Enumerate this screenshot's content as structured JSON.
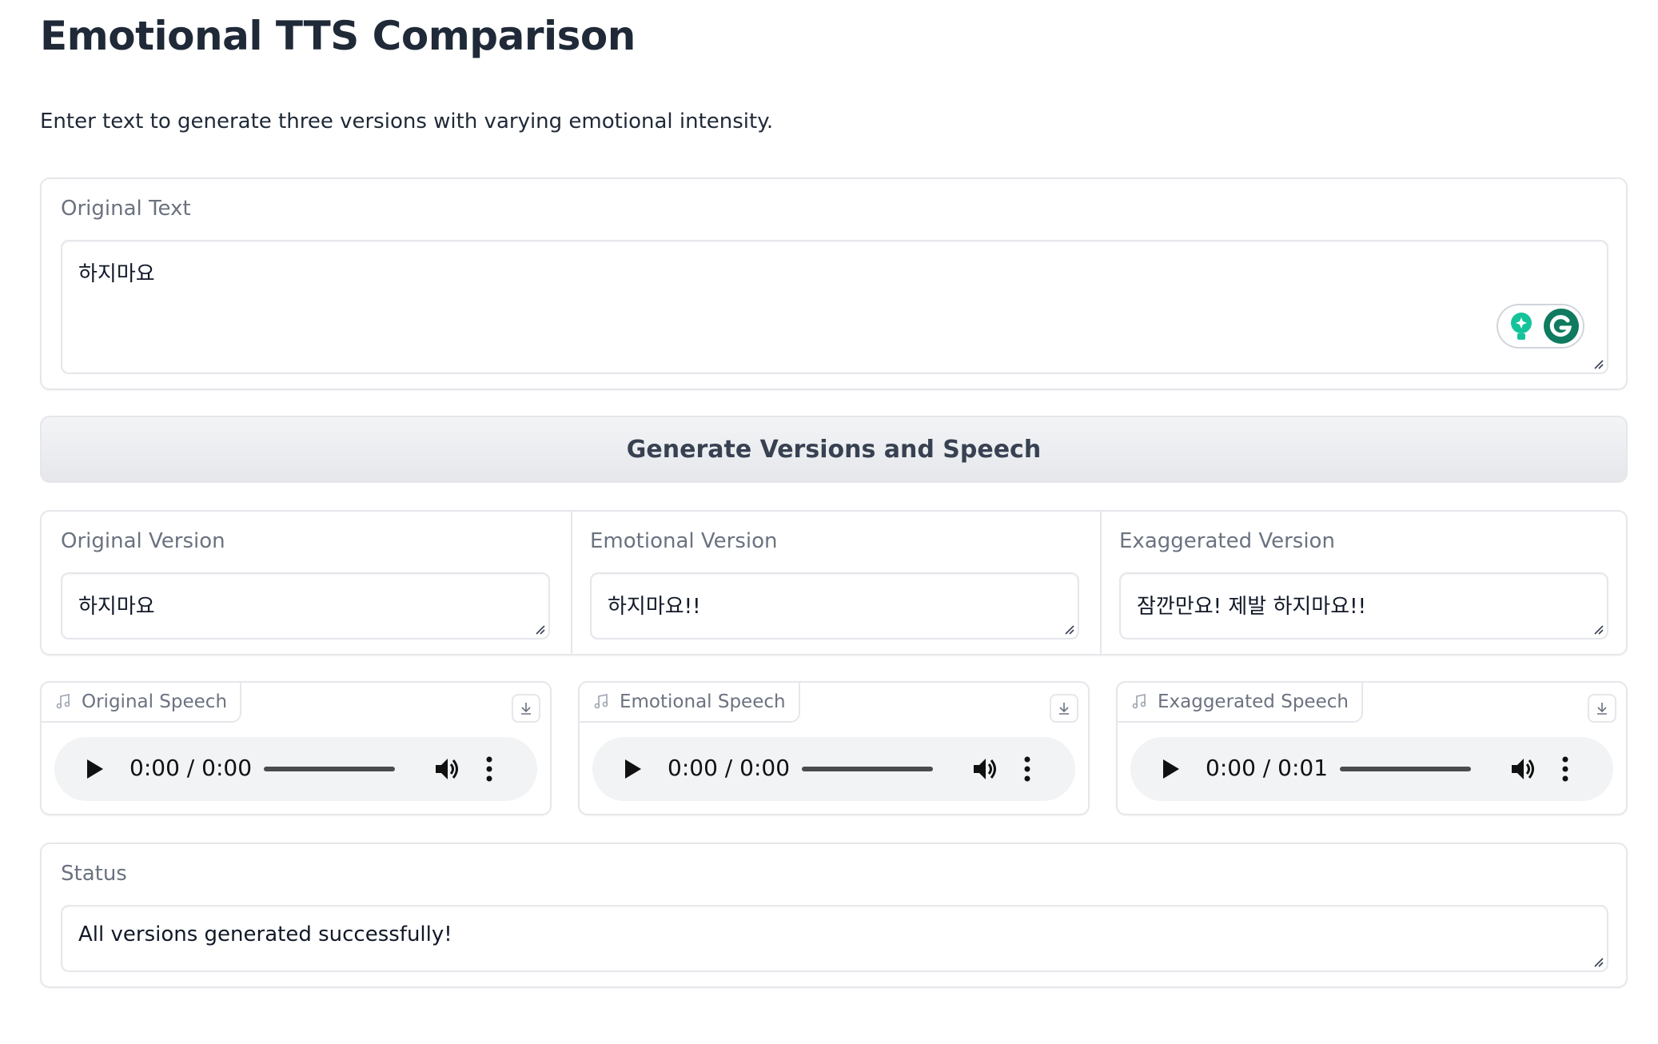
{
  "header": {
    "title": "Emotional TTS Comparison",
    "description": "Enter text to generate three versions with varying emotional intensity."
  },
  "input": {
    "label": "Original Text",
    "value": "하지마요"
  },
  "generate_button": {
    "label": "Generate Versions and Speech"
  },
  "versions": [
    {
      "label": "Original Version",
      "value": "하지마요"
    },
    {
      "label": "Emotional Version",
      "value": "하지마요!!"
    },
    {
      "label": "Exaggerated Version",
      "value": "잠깐만요! 제발 하지마요!!"
    }
  ],
  "audio": [
    {
      "label": "Original Speech",
      "current_time": "0:00",
      "duration": "0:00"
    },
    {
      "label": "Emotional Speech",
      "current_time": "0:00",
      "duration": "0:00"
    },
    {
      "label": "Exaggerated Speech",
      "current_time": "0:00",
      "duration": "0:01"
    }
  ],
  "status": {
    "label": "Status",
    "value": "All versions generated successfully!"
  },
  "icons": {
    "audio_tag": "music-note-icon",
    "download": "download-icon",
    "play": "play-icon",
    "volume": "volume-icon",
    "more": "more-vertical-icon",
    "grammarly": "grammarly-icon",
    "grammarly_suggestion": "lightbulb-icon"
  },
  "colors": {
    "grammarly_green": "#15c39a",
    "grammarly_dark": "#0f7a5f",
    "text_primary": "#1f2937",
    "label_gray": "#6b7280",
    "border": "#e5e7eb"
  }
}
